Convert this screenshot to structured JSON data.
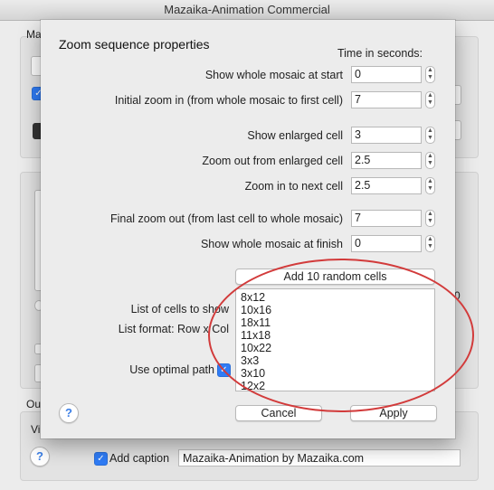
{
  "window": {
    "title": "Mazaika-Animation Commercial"
  },
  "background": {
    "label_ma": "Ma",
    "label_out": "Out",
    "label_vi": "Vi",
    "add_caption_label": "Add caption",
    "add_caption_checked": true,
    "caption_value": "Mazaika-Animation by Mazaika.com",
    "help_label": "?"
  },
  "dialog": {
    "title": "Zoom sequence properties",
    "column_header": "Time in seconds:",
    "rows": [
      {
        "label": "Show whole mosaic at start",
        "value": "0"
      },
      {
        "label": "Initial zoom in (from whole mosaic to first cell)",
        "value": "7"
      },
      {
        "label": "Show enlarged cell",
        "value": "3"
      },
      {
        "label": "Zoom out from enlarged cell",
        "value": "2.5"
      },
      {
        "label": "Zoom in to next cell",
        "value": "2.5"
      },
      {
        "label": "Final zoom out (from last cell to whole mosaic)",
        "value": "7"
      },
      {
        "label": "Show whole mosaic at finish",
        "value": "0"
      }
    ],
    "add_random_label": "Add 10 random cells",
    "cells_label": "List of cells to show",
    "format_label": "List format: Row x Col",
    "cells": [
      "8x12",
      "10x16",
      "18x11",
      "11x18",
      "10x22",
      "3x3",
      "3x10",
      "12x2"
    ],
    "optimal_path_label": "Use optimal path",
    "optimal_path_checked": true,
    "help_label": "?",
    "cancel_label": "Cancel",
    "apply_label": "Apply"
  },
  "annotation": {
    "color": "#d23b3b"
  }
}
